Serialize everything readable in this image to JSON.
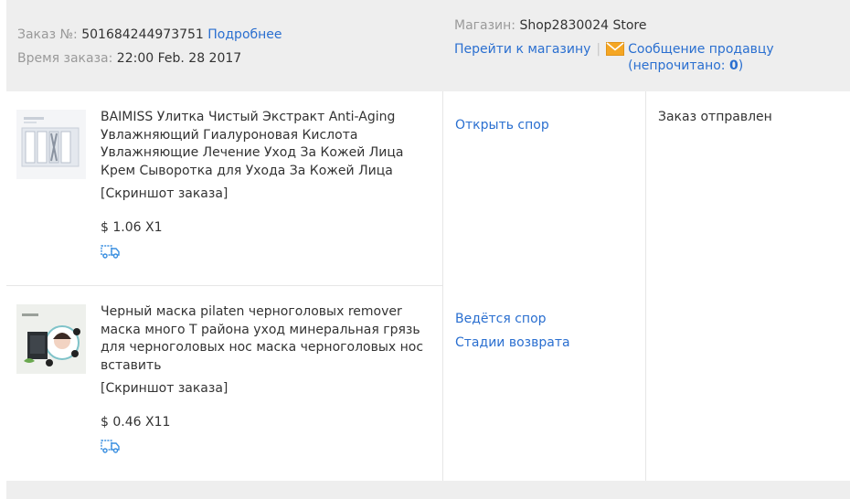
{
  "order": {
    "number_label": "Заказ №:",
    "number_value": "501684244973751",
    "details_link": "Подробнее",
    "time_label": "Время заказа:",
    "time_value": "22:00 Feb. 28 2017"
  },
  "store": {
    "label": "Магазин:",
    "name": "Shop2830024 Store",
    "go_link": "Перейти к магазину",
    "separator": "|",
    "message_link": "Сообщение продавцу",
    "unread_prefix": "(непрочитано: ",
    "unread_count": "0",
    "unread_suffix": ")"
  },
  "products": [
    {
      "title": "BAIMISS Улитка Чистый Экстракт Anti-Aging Увлажняющий Гиалуроновая Кислота Увлажняющие Лечение Уход За Кожей Лица Крем Сыворотка для Ухода За Кожей Лица",
      "screenshot_link": "[Скриншот заказа]",
      "price": "$ 1.06 X1",
      "action_primary": "Открыть спор"
    },
    {
      "title": "Черный маска pilaten черноголовых remover маска много Т района уход минеральная грязь для черноголовых нос маска черноголовых нос вставить",
      "screenshot_link": "[Скриншот заказа]",
      "price": "$ 0.46 X11",
      "action_primary": "Ведётся спор",
      "action_secondary": "Стадии возврата"
    }
  ],
  "status": "Заказ отправлен",
  "icons": {
    "mail": "mail-icon",
    "shipping": "shipping-truck-icon"
  },
  "colors": {
    "link": "#2a6fd0",
    "mail_icon": "#f5a623",
    "header_bg": "#eeeeee"
  }
}
